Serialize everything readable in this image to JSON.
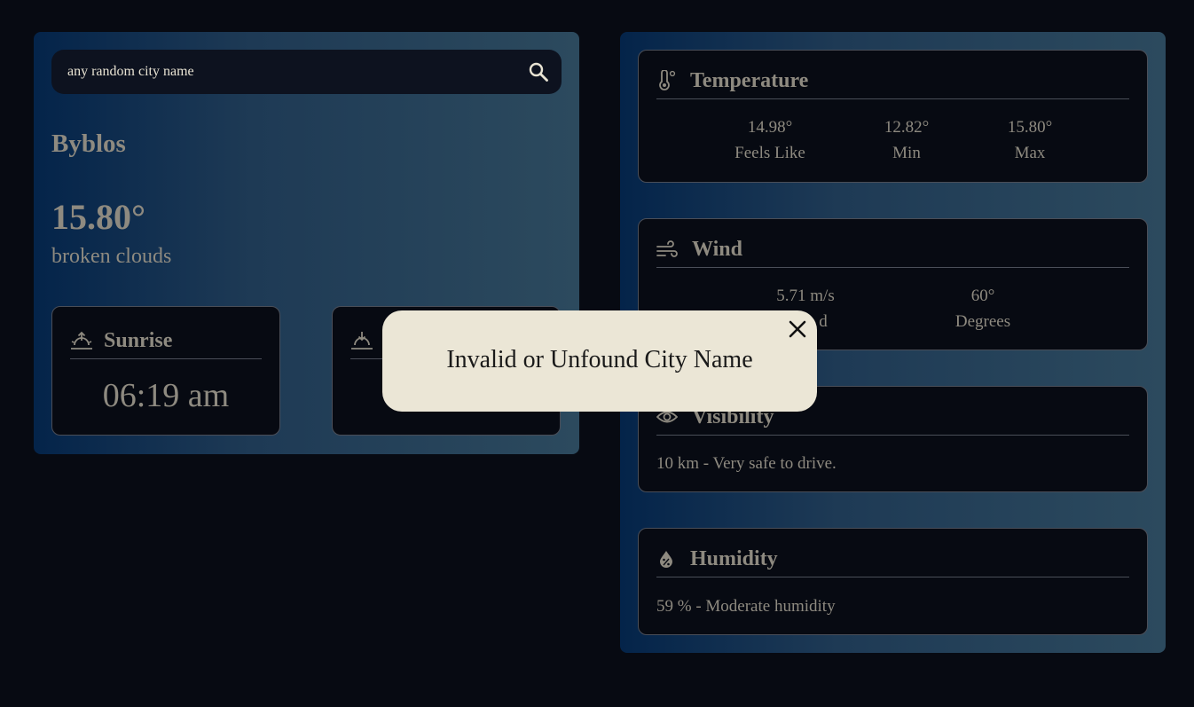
{
  "search": {
    "value": "any random city name",
    "icon": "search-icon"
  },
  "current": {
    "city": "Byblos",
    "temperature": "15.80°",
    "description": "broken clouds"
  },
  "sunrise": {
    "label": "Sunrise",
    "time": "06:19 am",
    "icon": "sunrise-icon"
  },
  "sunset": {
    "icon": "sunset-icon"
  },
  "temperature_card": {
    "title": "Temperature",
    "icon": "thermometer-icon",
    "stats": [
      {
        "value": "14.98°",
        "label": "Feels Like"
      },
      {
        "value": "12.82°",
        "label": "Min"
      },
      {
        "value": "15.80°",
        "label": "Max"
      }
    ]
  },
  "wind_card": {
    "title": "Wind",
    "icon": "wind-icon",
    "stats": [
      {
        "value": "5.71 m/s",
        "label": "d"
      },
      {
        "value": "60°",
        "label": "Degrees"
      }
    ]
  },
  "visibility_card": {
    "title": "Visibility",
    "icon": "eye-icon",
    "text": "10 km - Very safe to drive."
  },
  "humidity_card": {
    "title": "Humidity",
    "icon": "humidity-icon",
    "text": "59 % - Moderate humidity"
  },
  "popup": {
    "message": "Invalid or Unfound City Name",
    "icon": "close-icon"
  },
  "colors": {
    "background": "#070a12",
    "panel_gradient_start": "#04244a",
    "panel_gradient_end": "#2c4a5e",
    "text_muted": "#8e8a80",
    "popup_bg": "#ebe6d6"
  }
}
